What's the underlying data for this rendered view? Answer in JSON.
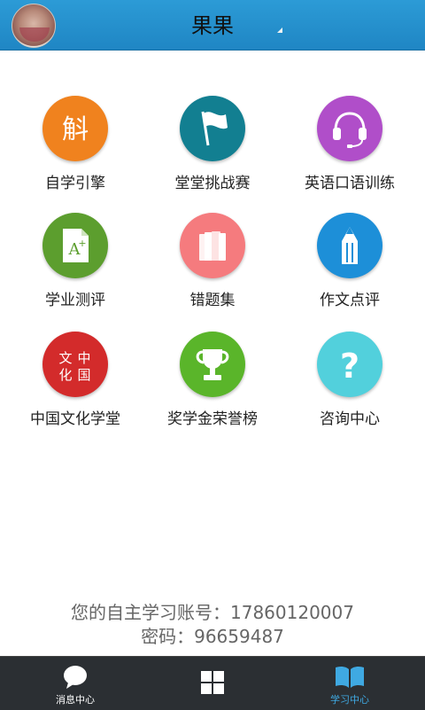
{
  "header": {
    "title": "果果"
  },
  "grid": [
    {
      "label": "自学引擎",
      "icon": "self-study-icon",
      "color": "#f0821e"
    },
    {
      "label": "堂堂挑战赛",
      "icon": "flag-icon",
      "color": "#127f91"
    },
    {
      "label": "英语口语训练",
      "icon": "headset-icon",
      "color": "#b04ec9"
    },
    {
      "label": "学业测评",
      "icon": "grade-document-icon",
      "color": "#5c9e2e"
    },
    {
      "label": "错题集",
      "icon": "book-stack-icon",
      "color": "#f57b7e"
    },
    {
      "label": "作文点评",
      "icon": "pencil-icon",
      "color": "#1d8fd8"
    },
    {
      "label": "中国文化学堂",
      "icon": "chinese-seal-icon",
      "color": "#d32b2b"
    },
    {
      "label": "奖学金荣誉榜",
      "icon": "trophy-icon",
      "color": "#5ab52a"
    },
    {
      "label": "咨询中心",
      "icon": "question-icon",
      "color": "#52d0dc"
    }
  ],
  "account": {
    "text": "您的自主学习账号：17860120007",
    "password": "密码：96659487"
  },
  "tabbar": {
    "items": [
      {
        "label": "消息中心",
        "icon": "chat-bubble-icon"
      },
      {
        "label": "",
        "icon": "grid-icon"
      },
      {
        "label": "学习中心",
        "icon": "open-book-icon"
      }
    ],
    "active_color": "#3fa9e2"
  }
}
